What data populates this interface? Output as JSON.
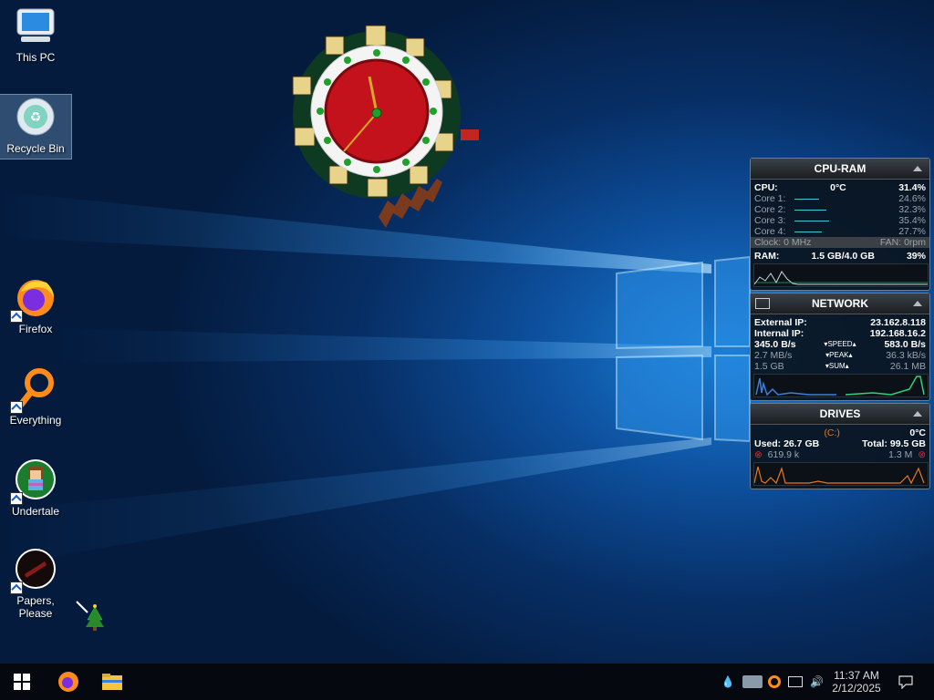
{
  "desktop": {
    "icons": [
      {
        "label": "This PC"
      },
      {
        "label": "Recycle Bin"
      },
      {
        "label": "Firefox"
      },
      {
        "label": "Everything"
      },
      {
        "label": "Undertale"
      },
      {
        "label": "Papers, Please"
      }
    ]
  },
  "cpu_ram": {
    "title": "CPU-RAM",
    "cpu_label": "CPU:",
    "cpu_temp": "0°C",
    "cpu_value": "31.4%",
    "cores": [
      {
        "label": "Core 1:",
        "value": "24.6%",
        "level": 0.246
      },
      {
        "label": "Core 2:",
        "value": "32.3%",
        "level": 0.323
      },
      {
        "label": "Core 3:",
        "value": "35.4%",
        "level": 0.354
      },
      {
        "label": "Core 4:",
        "value": "27.7%",
        "level": 0.277
      }
    ],
    "clock": "Clock: 0 MHz",
    "fan": "FAN: 0rpm",
    "ram_label": "RAM:",
    "ram_value": "1.5 GB/4.0 GB",
    "ram_pct": "39%"
  },
  "network": {
    "title": "NETWORK",
    "external_label": "External IP:",
    "external_ip": "23.162.8.118",
    "internal_label": "Internal IP:",
    "internal_ip": "192.168.16.2",
    "down_speed": "345.0 B/s",
    "speed_label": "SPEED",
    "up_speed": "583.0 B/s",
    "down_peak": "2.7 MB/s",
    "peak_label": "PEAK",
    "up_peak": "36.3 kB/s",
    "down_sum": "1.5 GB",
    "sum_label": "SUM",
    "up_sum": "26.1 MB"
  },
  "drives": {
    "title": "DRIVES",
    "drive": "(C:)",
    "temp": "0°C",
    "used": "Used: 26.7 GB",
    "total": "Total: 99.5 GB",
    "read": "619.9 k",
    "write": "1.3 M"
  },
  "taskbar": {
    "time": "11:37 AM",
    "date": "2/12/2025"
  },
  "colors": {
    "accent_green": "#2fd07a",
    "accent_cyan": "#3cc7d8",
    "drive_orange": "#e8781e"
  }
}
